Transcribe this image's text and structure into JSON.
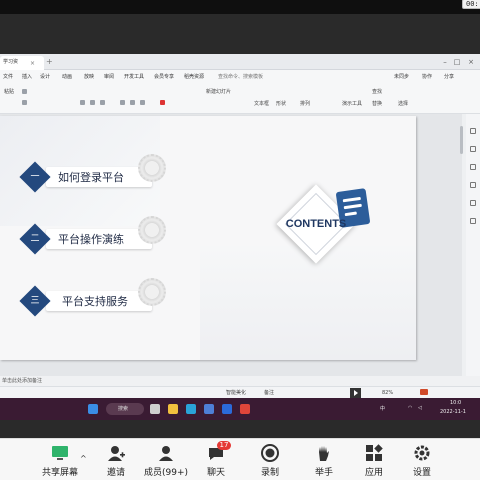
{
  "meeting": {
    "timer": "00:"
  },
  "wps": {
    "doc_tab": "学习资",
    "tab_close": "×",
    "tab_add": "+",
    "menus": [
      "设计",
      "动画",
      "放映",
      "审阅",
      "视图",
      "开发工具",
      "会员专享",
      "稻壳资源"
    ],
    "menu_left": [
      "文件",
      "插入"
    ],
    "search_placeholder": "查找命令、搜索模板",
    "menu_right": [
      "未同步",
      "协作",
      "分享"
    ],
    "toolbar": {
      "paste": "粘贴",
      "new_slide": "新建幻灯片",
      "text_box": "文本框",
      "shape": "形状",
      "arrange": "排列",
      "find": "查找",
      "replace": "替换",
      "select": "选择",
      "presenter": "演示工具"
    },
    "notes_placeholder": "单击此处添加备注",
    "status": {
      "smart_beautify": "智能美化",
      "notes": "备注",
      "zoom": "82%"
    }
  },
  "slide": {
    "agenda": [
      {
        "num": "一",
        "label": "如何登录平台"
      },
      {
        "num": "二",
        "label": "平台操作演练"
      },
      {
        "num": "三",
        "label": "平台支持服务"
      }
    ],
    "contents_title": "CONTENTS"
  },
  "taskbar": {
    "search": "搜索",
    "ime": "中",
    "time": "10:0",
    "date": "2022-11-1"
  },
  "controls": [
    {
      "label": "共享屏幕",
      "icon": "share-screen-icon"
    },
    {
      "label": "邀请",
      "icon": "invite-icon"
    },
    {
      "label": "成员(99+)",
      "icon": "members-icon"
    },
    {
      "label": "聊天",
      "icon": "chat-icon"
    },
    {
      "label": "录制",
      "icon": "record-icon"
    },
    {
      "label": "举手",
      "icon": "raise-hand-icon"
    },
    {
      "label": "应用",
      "icon": "apps-icon"
    },
    {
      "label": "设置",
      "icon": "settings-icon"
    }
  ],
  "chat_badge": "17",
  "colors": {
    "accent_navy": "#24497e",
    "taskbar": "#3a1b33",
    "badge_red": "#e53935"
  }
}
